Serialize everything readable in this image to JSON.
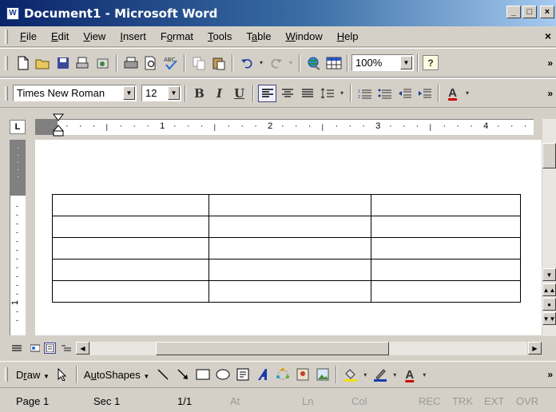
{
  "window": {
    "app_icon_letter": "W",
    "title": "Document1 - Microsoft Word",
    "min_glyph": "_",
    "max_glyph": "□",
    "close_glyph": "×"
  },
  "menu": {
    "items": [
      {
        "pre": "",
        "u": "F",
        "post": "ile"
      },
      {
        "pre": "",
        "u": "E",
        "post": "dit"
      },
      {
        "pre": "",
        "u": "V",
        "post": "iew"
      },
      {
        "pre": "",
        "u": "I",
        "post": "nsert"
      },
      {
        "pre": "F",
        "u": "o",
        "post": "rmat"
      },
      {
        "pre": "",
        "u": "T",
        "post": "ools"
      },
      {
        "pre": "T",
        "u": "a",
        "post": "ble"
      },
      {
        "pre": "",
        "u": "W",
        "post": "indow"
      },
      {
        "pre": "",
        "u": "H",
        "post": "elp"
      }
    ],
    "doc_close_glyph": "×"
  },
  "standard_toolbar": {
    "zoom_value": "100%",
    "help_glyph": "?",
    "more_glyph": "»"
  },
  "formatting_toolbar": {
    "font_name": "Times New Roman",
    "font_size": "12",
    "bold_glyph": "B",
    "italic_glyph": "I",
    "underline_glyph": "U",
    "font_color_glyph": "A",
    "more_glyph": "»"
  },
  "ruler": {
    "corner_glyph": "L",
    "numbers": [
      "1",
      "2",
      "3",
      "4"
    ]
  },
  "table": {
    "rows": 5,
    "columns": 3
  },
  "drawing_toolbar": {
    "draw": {
      "pre": "D",
      "u": "r",
      "post": "aw"
    },
    "autoshapes": {
      "pre": "A",
      "u": "u",
      "post": "toShapes"
    },
    "font_color_glyph": "A",
    "more_glyph": "»"
  },
  "status_bar": {
    "page": "Page 1",
    "section": "Sec 1",
    "page_of": "1/1",
    "at": "At",
    "ln": "Ln",
    "col": "Col",
    "rec": "REC",
    "trk": "TRK",
    "ext": "EXT",
    "ovr": "OVR"
  },
  "colors": {
    "title_gradient_start": "#0a246a",
    "title_gradient_end": "#a6caf0",
    "chrome": "#d4d0c8",
    "disabled_text": "#9a9a9a"
  }
}
